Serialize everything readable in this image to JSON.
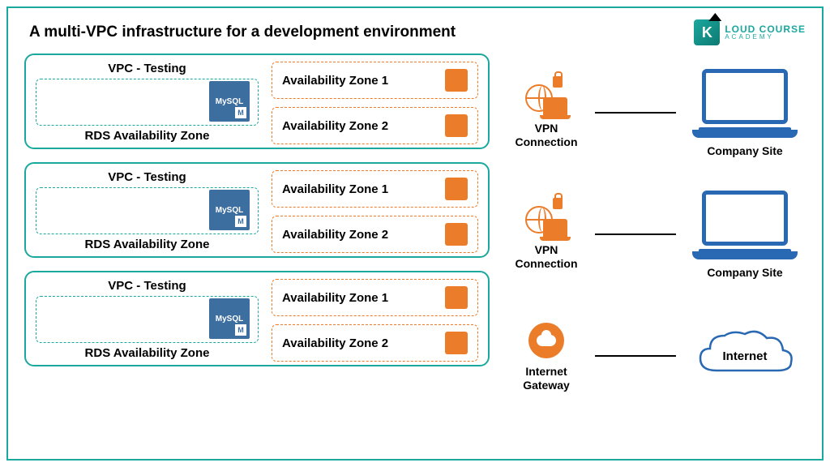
{
  "title": "A multi-VPC infrastructure for a development environment",
  "logo": {
    "brand_top": "LOUD COURSE",
    "brand_bot": "ACADEMY",
    "letter": "K"
  },
  "vpcs": [
    {
      "title": "VPC - Testing",
      "rds": "RDS Availability Zone",
      "db": "MySQL",
      "az1": "Availability Zone 1",
      "az2": "Availability Zone 2"
    },
    {
      "title": "VPC - Testing",
      "rds": "RDS Availability Zone",
      "db": "MySQL",
      "az1": "Availability Zone 1",
      "az2": "Availability Zone 2"
    },
    {
      "title": "VPC - Testing",
      "rds": "RDS Availability Zone",
      "db": "MySQL",
      "az1": "Availability Zone 1",
      "az2": "Availability Zone 2"
    }
  ],
  "connections": [
    {
      "type": "vpn",
      "label": "VPN Connection",
      "target": "Company Site"
    },
    {
      "type": "vpn",
      "label": "VPN Connection",
      "target": "Company Site"
    },
    {
      "type": "igw",
      "label": "Internet Gateway",
      "target": "Internet"
    }
  ]
}
